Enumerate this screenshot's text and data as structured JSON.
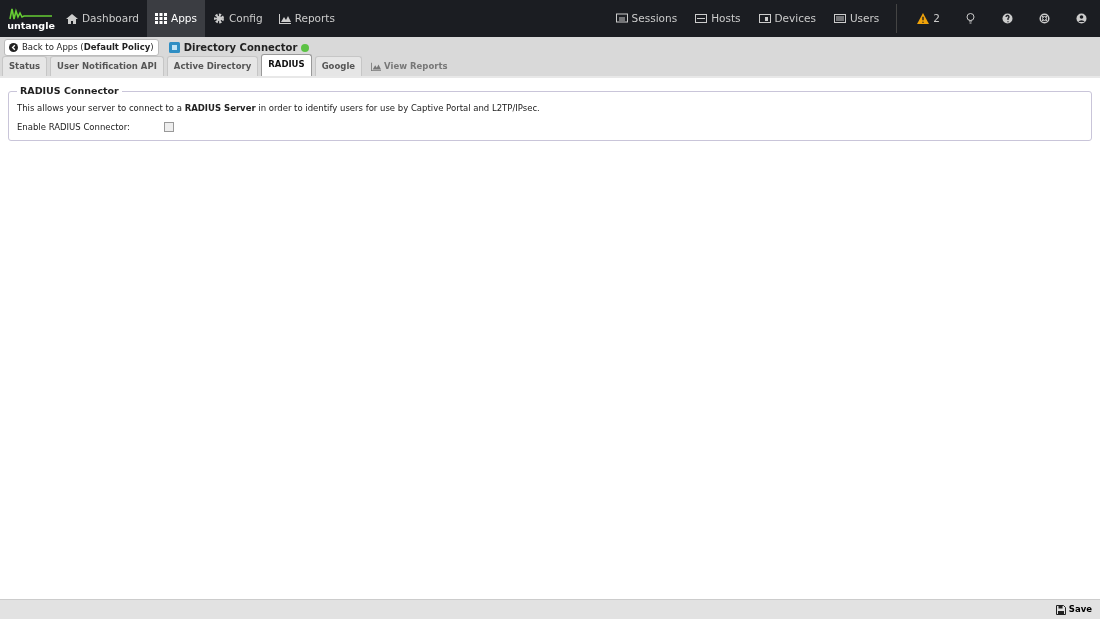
{
  "logo": {
    "text": "untangle"
  },
  "nav_left": [
    {
      "label": "Dashboard",
      "selected": false
    },
    {
      "label": "Apps",
      "selected": true
    },
    {
      "label": "Config",
      "selected": false
    },
    {
      "label": "Reports",
      "selected": false
    }
  ],
  "nav_right": [
    {
      "label": "Sessions"
    },
    {
      "label": "Hosts"
    },
    {
      "label": "Devices"
    },
    {
      "label": "Users"
    }
  ],
  "alerts": {
    "count": "2"
  },
  "header": {
    "back_button": "Back to Apps (**Default Policy**)",
    "app_name": "Directory Connector",
    "running": true
  },
  "tabs": [
    {
      "label": "Status",
      "kind": "tab",
      "selected": false
    },
    {
      "label": "User Notification API",
      "kind": "tab",
      "selected": false
    },
    {
      "label": "Active Directory",
      "kind": "tab",
      "selected": false
    },
    {
      "label": "RADIUS",
      "kind": "tab",
      "selected": true
    },
    {
      "label": "Google",
      "kind": "tab",
      "selected": false
    },
    {
      "label": "View Reports",
      "kind": "link"
    }
  ],
  "panel": {
    "legend": "RADIUS Connector",
    "description": "This allows your server to connect to a **RADIUS Server** in order to identify users for use by Captive Portal and L2TP/IPsec.",
    "checkbox_label": "Enable RADIUS Connector:",
    "checked": false
  },
  "footer": {
    "save": "Save"
  }
}
